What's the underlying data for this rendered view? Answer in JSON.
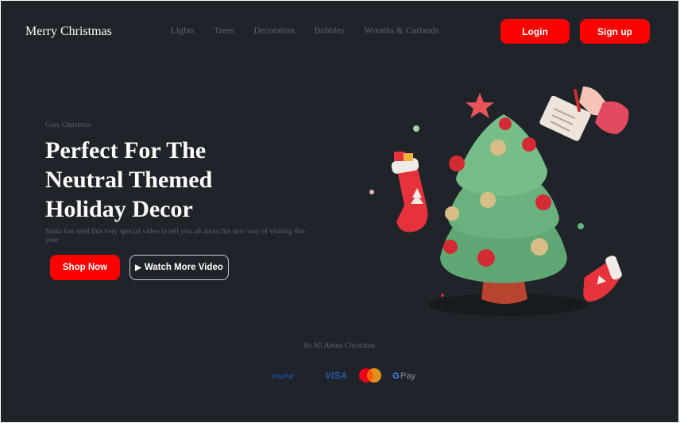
{
  "header": {
    "brand": "Merry Christmas",
    "nav": [
      "Lights",
      "Trees",
      "Decoration",
      "Bubbles",
      "Wreaths & Garlands"
    ],
    "login_label": "Login",
    "signup_label": "Sign up"
  },
  "hero": {
    "eyebrow": "Cosy Christmas",
    "headline": "Perfect For The Neutral Themed Holiday Decor",
    "subtext": "Santa has send this very special video to tell you all about his new way of visiting this year",
    "shop_label": "Shop Now",
    "watch_label": "Watch More Video",
    "illustration_icon": "christmas-tree-illustration"
  },
  "footer": {
    "about": "Its All About Christmas",
    "payments": [
      {
        "name": "paypal-logo",
        "text": "PayPal"
      },
      {
        "name": "visa-logo",
        "text": "VISA"
      },
      {
        "name": "mastercard-logo",
        "text": ""
      },
      {
        "name": "gpay-logo",
        "text": "Pay"
      }
    ]
  },
  "colors": {
    "background": "#1f232a",
    "accent": "#ff0000",
    "muted_text": "#5d6470",
    "tree_green": "#5fa773"
  }
}
